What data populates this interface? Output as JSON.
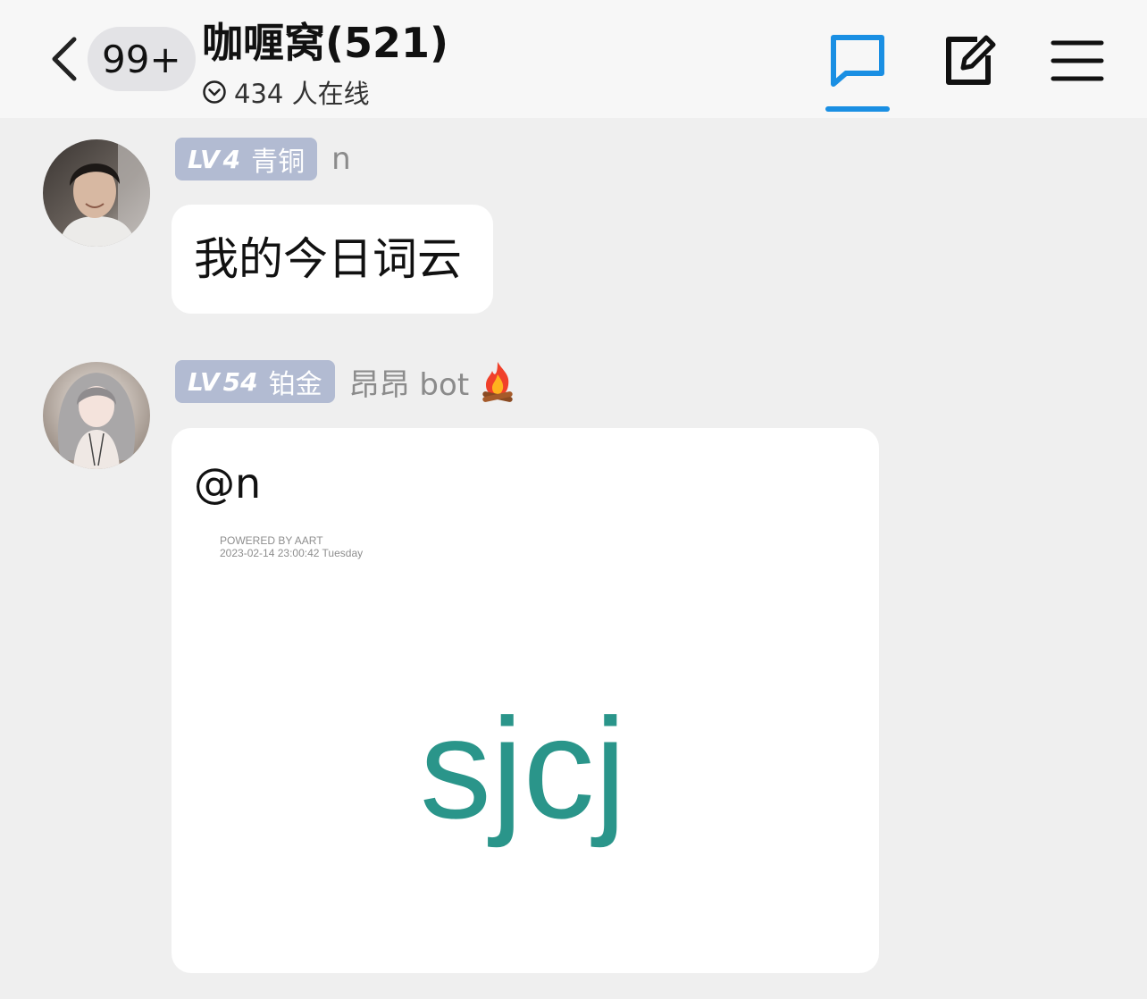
{
  "header": {
    "unread_count": "99+",
    "group_title": "咖喱窝(521)",
    "online_status": "434 人在线",
    "active_tab_color": "#1a8fe3",
    "icons": [
      "back-icon",
      "chevron-down-circle-icon",
      "chat-bubble-icon",
      "edit-icon",
      "menu-icon"
    ]
  },
  "messages": [
    {
      "level_prefix": "LV",
      "level_number": "4",
      "level_title": "青铜",
      "nickname": "n",
      "text": "我的今日词云"
    },
    {
      "level_prefix": "LV",
      "level_number": "54",
      "level_title": "铂金",
      "nickname": "昂昂 bot",
      "nickname_emoji": "campfire-icon",
      "mention": "@n",
      "wordcloud": {
        "powered_by": "POWERED BY AART",
        "timestamp": "2023-02-14   23:00:42   Tuesday",
        "word": "sjcj",
        "word_color": "#2a958a"
      }
    }
  ]
}
